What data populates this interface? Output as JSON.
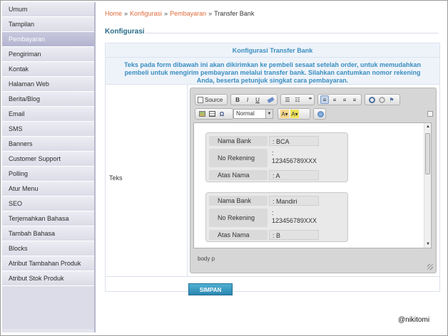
{
  "sidebar": {
    "items": [
      {
        "label": "Umum",
        "active": false
      },
      {
        "label": "Tampilan",
        "active": false
      },
      {
        "label": "Pembayaran",
        "active": true
      },
      {
        "label": "Pengiriman",
        "active": false
      },
      {
        "label": "Kontak",
        "active": false
      },
      {
        "label": "Halaman Web",
        "active": false
      },
      {
        "label": "Berita/Blog",
        "active": false
      },
      {
        "label": "Email",
        "active": false
      },
      {
        "label": "SMS",
        "active": false
      },
      {
        "label": "Banners",
        "active": false
      },
      {
        "label": "Customer Support",
        "active": false
      },
      {
        "label": "Polling",
        "active": false
      },
      {
        "label": "Atur Menu",
        "active": false
      },
      {
        "label": "SEO",
        "active": false
      },
      {
        "label": "Terjemahkan Bahasa",
        "active": false
      },
      {
        "label": "Tambah Bahasa",
        "active": false
      },
      {
        "label": "Blocks",
        "active": false
      },
      {
        "label": "Atribut Tambahan Produk",
        "active": false
      },
      {
        "label": "Atribut Stok Produk",
        "active": false
      }
    ]
  },
  "breadcrumb": {
    "home": "Home",
    "konfigurasi": "Konfigurasi",
    "pembayaran": "Pembayaran",
    "current": "Transfer Bank",
    "separator": "»"
  },
  "section_title": "Konfigurasi",
  "form": {
    "header": "Konfigurasi Transfer Bank",
    "description": "Teks pada form dibawah ini akan dikirimkan ke pembeli sesaat setelah order, untuk memudahkan pembeli untuk mengirim pembayaran melalui transfer bank. Silahkan cantumkan nomor rekening Anda, beserta petunjuk singkat cara pembayaran.",
    "field_label": "Teks",
    "save_label": "SIMPAN"
  },
  "editor": {
    "source_label": "Source",
    "bold": "B",
    "italic": "I",
    "underline": "U",
    "format_value": "Normal",
    "status_path": "body  p",
    "banks": [
      {
        "name_label": "Nama Bank",
        "name_value": ": BCA",
        "account_label": "No Rekening",
        "account_prefix": ":",
        "account_value": "123456789XXX",
        "holder_label": "Atas Nama",
        "holder_value": ": A"
      },
      {
        "name_label": "Nama Bank",
        "name_value": ": Mandiri",
        "account_label": "No Rekening",
        "account_prefix": ":",
        "account_value": "123456789XXX",
        "holder_label": "Atas Nama",
        "holder_value": ": B"
      }
    ]
  },
  "credit": "@nikitomi",
  "colors": {
    "accent": "#3a8ec0",
    "link": "#e06a3a",
    "title": "#2a6b8a",
    "button": "#2a86b0"
  }
}
